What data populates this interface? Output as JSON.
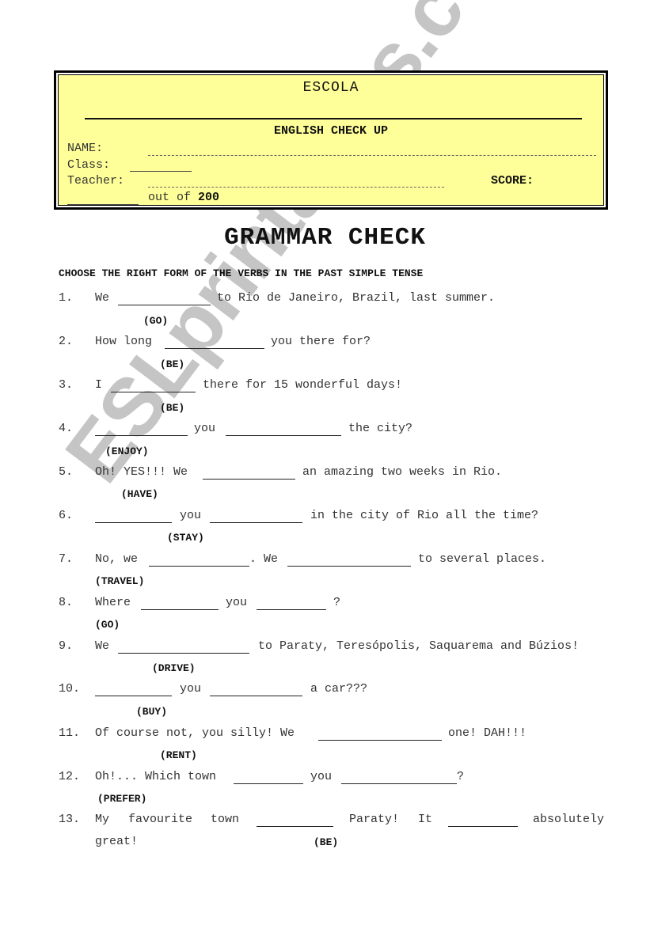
{
  "header": {
    "school_label": "ESCOLA",
    "subtitle": "ENGLISH CHECK UP",
    "name_label": "NAME:",
    "class_label": "Class:",
    "teacher_label": "Teacher:",
    "score_label": "SCORE:",
    "out_of_text": "out of",
    "max_score": "200",
    "box_color": "#ffff99"
  },
  "title": "GRAMMAR CHECK",
  "instruction": "CHOOSE THE RIGHT FORM OF THE VERBS IN THE PAST SIMPLE TENSE",
  "items": [
    {
      "number": "1.",
      "parts": [
        "We",
        "to Rio de Janeiro, Brazil, last summer."
      ],
      "verb": "(GO)"
    },
    {
      "number": "2.",
      "parts": [
        "How long",
        "you there for?"
      ],
      "verb": "(BE)"
    },
    {
      "number": "3.",
      "parts": [
        "I",
        "there for 15 wonderful days!"
      ],
      "verb": "(BE)"
    },
    {
      "number": "4.",
      "parts": [
        "you",
        "the city?"
      ],
      "verb": "(ENJOY)"
    },
    {
      "number": "5.",
      "parts": [
        "Oh! YES!!! We",
        "an amazing two weeks in Rio."
      ],
      "verb": "(HAVE)"
    },
    {
      "number": "6.",
      "parts": [
        "you",
        "in the city of Rio all the time?"
      ],
      "verb": "(STAY)"
    },
    {
      "number": "7.",
      "parts": [
        "No, we",
        ". We",
        "to several places."
      ],
      "verb": "(TRAVEL)"
    },
    {
      "number": "8.",
      "parts": [
        "Where",
        "you",
        "?"
      ],
      "verb": "(GO)"
    },
    {
      "number": "9.",
      "parts": [
        "We",
        "to Paraty, Teresópolis, Saquarema and Búzios!"
      ],
      "verb": "(DRIVE)"
    },
    {
      "number": "10.",
      "parts": [
        "you",
        "a car???"
      ],
      "verb": "(BUY)"
    },
    {
      "number": "11.",
      "parts": [
        "Of course not, you silly! We",
        "one! DAH!!!"
      ],
      "verb": "(RENT)"
    },
    {
      "number": "12.",
      "parts": [
        "Oh!... Which town",
        "you",
        "?"
      ],
      "verb": "(PREFER)"
    },
    {
      "number": "13.",
      "parts": [
        "My",
        "favourite",
        "town",
        "Paraty!",
        "It",
        "absolutely",
        "great!"
      ],
      "verb": "(BE)"
    }
  ],
  "watermark": "ESLprintables.com"
}
